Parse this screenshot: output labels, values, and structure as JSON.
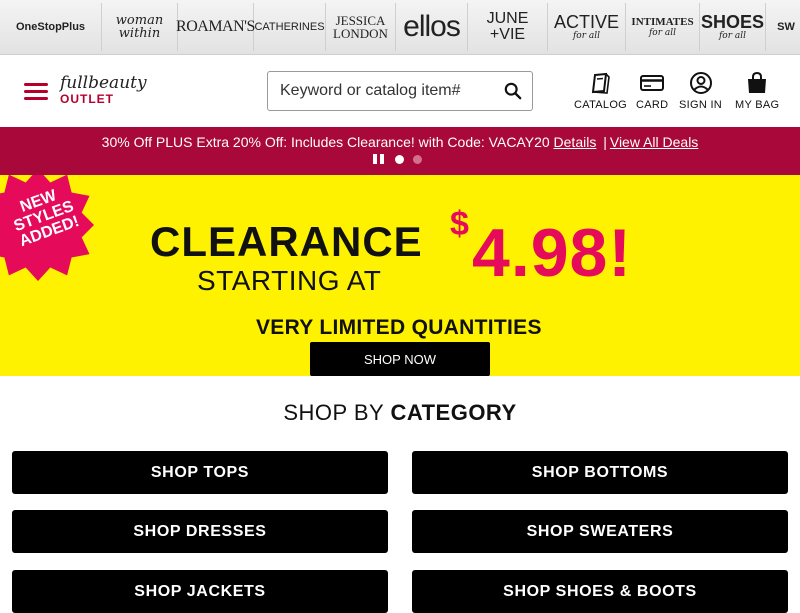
{
  "brands": [
    {
      "line1": "OneStopPlus",
      "line2": ""
    },
    {
      "line1": "woman",
      "line2": "within"
    },
    {
      "line1": "ROAMAN'S",
      "line2": ""
    },
    {
      "line1": "CATHERINES",
      "line2": ""
    },
    {
      "line1": "JESSICA",
      "line2": "LONDON"
    },
    {
      "line1": "ellos",
      "line2": ""
    },
    {
      "line1": "JUNE",
      "line2": "+VIE"
    },
    {
      "line1": "ACTIVE",
      "line2": "for all"
    },
    {
      "line1": "INTIMATES",
      "line2": "for all"
    },
    {
      "line1": "SHOES",
      "line2": "for all"
    },
    {
      "line1": "SW",
      "line2": ""
    }
  ],
  "header": {
    "logo_script": "fullbeauty",
    "logo_outlet": "OUTLET",
    "search_placeholder": "Keyword or catalog item#",
    "nav": {
      "catalog": "CATALOG",
      "card": "CARD",
      "signin": "SIGN IN",
      "bag": "MY BAG"
    }
  },
  "promo": {
    "text": "30% Off PLUS Extra 20% Off: Includes Clearance! with Code: VACAY20",
    "details_link": "Details",
    "separator": "|",
    "all_deals_link": "View All Deals",
    "slide_count": 2,
    "active_slide": 1
  },
  "hero": {
    "badge_line1": "NEW",
    "badge_line2": "STYLES",
    "badge_line3": "ADDED!",
    "headline": "CLEARANCE",
    "subheadline": "STARTING AT",
    "price_currency": "$",
    "price_amount": "4.98!",
    "note": "VERY LIMITED QUANTITIES",
    "cta": "SHOP NOW"
  },
  "categories": {
    "title_light": "SHOP BY",
    "title_bold": "CATEGORY",
    "items": [
      "SHOP TOPS",
      "SHOP BOTTOMS",
      "SHOP DRESSES",
      "SHOP SWEATERS",
      "SHOP JACKETS",
      "SHOP SHOES & BOOTS"
    ]
  },
  "colors": {
    "brand_red": "#b5002e",
    "promo_bg": "#a8083a",
    "hero_yellow": "#fff200",
    "hero_pink": "#e60a5a",
    "button_black": "#000000"
  }
}
